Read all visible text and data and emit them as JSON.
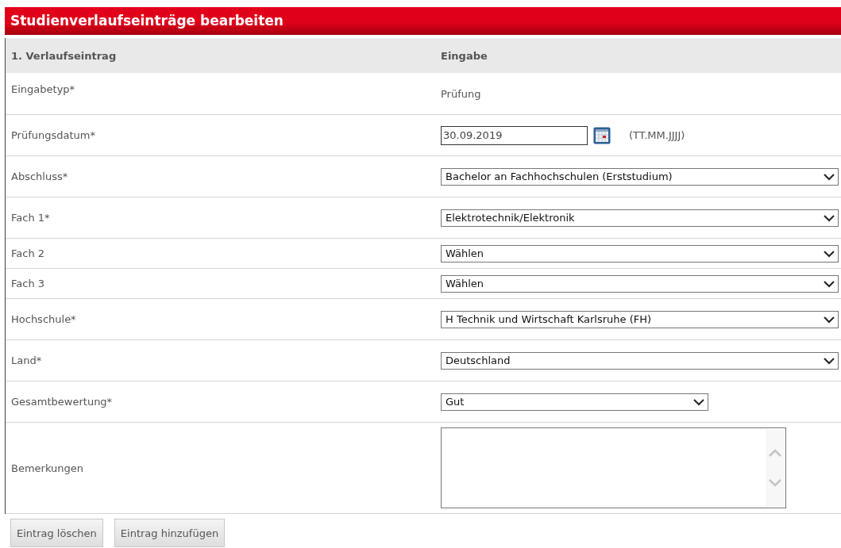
{
  "title": "Studienverlaufseinträge bearbeiten",
  "table": {
    "columns": [
      "1. Verlaufseintrag",
      "Eingabe"
    ],
    "rows": [
      {
        "kind": "text",
        "label": "Eingabetyp*",
        "value": "Prüfung"
      },
      {
        "kind": "date",
        "label": "Prüfungsdatum*",
        "value": "30.09.2019",
        "hint": "(TT.MM.JJJJ)"
      },
      {
        "kind": "select",
        "label": "Abschluss*",
        "value": "Bachelor an Fachhochschulen (Erststudium)"
      },
      {
        "kind": "select",
        "label": "Fach 1*",
        "value": "Elektrotechnik/Elektronik"
      },
      {
        "kind": "select_compact",
        "label": "Fach 2",
        "value": "Wählen"
      },
      {
        "kind": "select_compact",
        "label": "Fach 3",
        "value": "Wählen"
      },
      {
        "kind": "select",
        "label": "Hochschule*",
        "value": "H Technik und Wirtschaft Karlsruhe (FH)"
      },
      {
        "kind": "select",
        "label": "Land*",
        "value": "Deutschland"
      },
      {
        "kind": "select_short",
        "label": "Gesamtbewertung*",
        "value": "Gut"
      },
      {
        "kind": "textarea",
        "label": "Bemerkungen"
      }
    ]
  },
  "buttons": [
    "Eintrag löschen",
    "Eintrag hinzufügen"
  ]
}
